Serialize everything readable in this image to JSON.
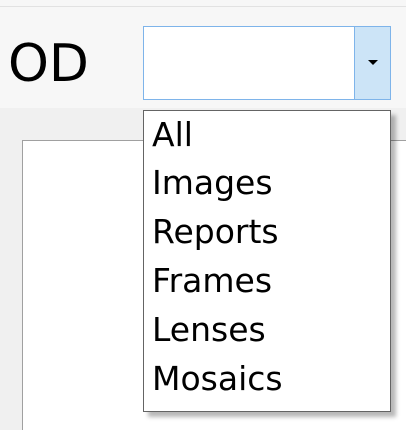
{
  "header": {
    "eye_label": "OD"
  },
  "combo": {
    "value": "",
    "icon": "chevron-down-icon"
  },
  "dropdown": {
    "options": [
      "All",
      "Images",
      "Reports",
      "Frames",
      "Lenses",
      "Mosaics"
    ]
  },
  "colors": {
    "combo_border": "#7eb4ea",
    "combo_button": "#cce4f7"
  }
}
